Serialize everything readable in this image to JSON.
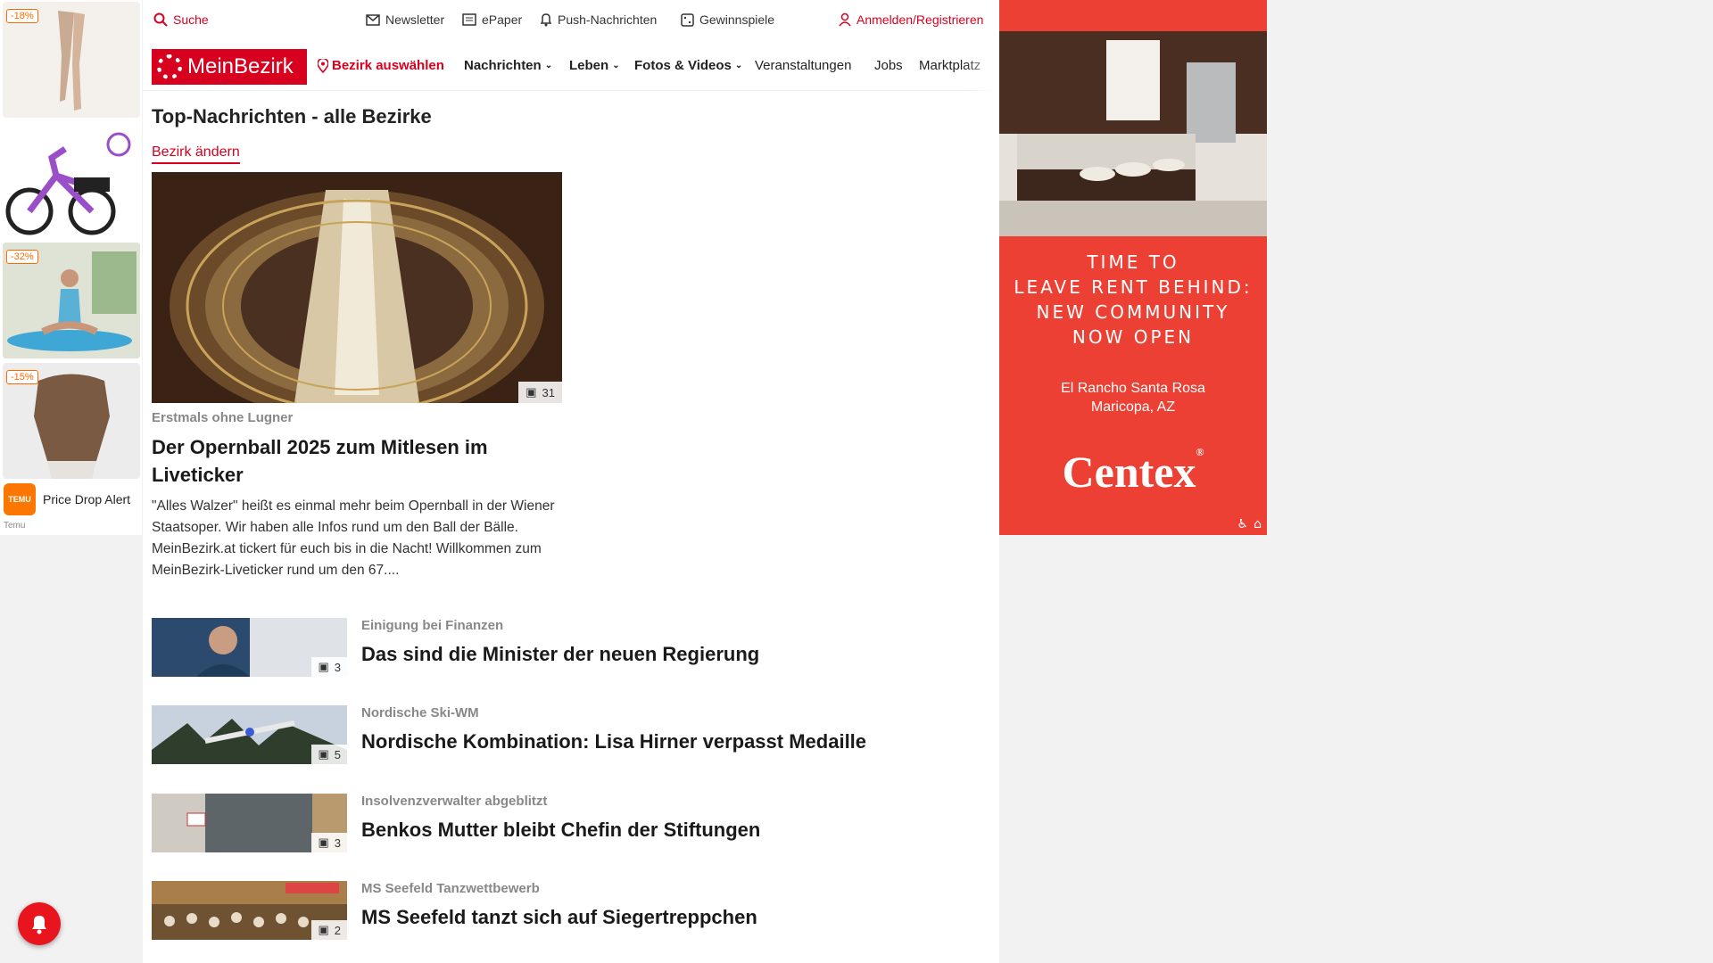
{
  "left_ad": {
    "tiles": [
      {
        "badge": "-18%"
      },
      {
        "badge": ""
      },
      {
        "badge": "-32%"
      },
      {
        "badge": "-15%"
      }
    ],
    "promo_text": "Price Drop Alert",
    "logo_text": "TEMU",
    "brand": "Temu"
  },
  "topbar": {
    "search": "Suche",
    "newsletter": "Newsletter",
    "epaper": "ePaper",
    "push": "Push-Nachrichten",
    "gewinnspiele": "Gewinnspiele",
    "login": "Anmelden/Registrieren"
  },
  "nav": {
    "logo": "MeinBezirk",
    "bezirk": "Bezirk auswählen",
    "items": [
      "Nachrichten",
      "Leben",
      "Fotos & Videos",
      "Veranstaltungen",
      "Jobs",
      "Marktplatz"
    ]
  },
  "section": {
    "title": "Top-Nachrichten - alle Bezirke",
    "change_link": "Bezirk ändern"
  },
  "hero": {
    "photo_count": "31",
    "kicker": "Erstmals ohne Lugner",
    "title": "Der Opernball 2025 zum Mitlesen im Liveticker",
    "teaser": "\"Alles Walzer\" heißt es einmal mehr beim Opernball in der Wiener Staatsoper. Wir haben alle Infos rund um den Ball der Bälle. MeinBezirk.at tickert für euch bis in die Nacht! Willkommen zum MeinBezirk-Liveticker rund um den 67...."
  },
  "articles": [
    {
      "kicker": "Einigung bei Finanzen",
      "title": "Das sind die Minister der neuen Regierung",
      "photo_count": "3"
    },
    {
      "kicker": "Nordische Ski-WM",
      "title": "Nordische Kombination: Lisa Hirner verpasst Medaille",
      "photo_count": "5"
    },
    {
      "kicker": "Insolvenzverwalter abgeblitzt",
      "title": "Benkos Mutter bleibt Chefin der Stiftungen",
      "photo_count": "3"
    },
    {
      "kicker": "MS Seefeld Tanzwettbewerb",
      "title": "MS Seefeld tanzt sich auf Siegertreppchen",
      "photo_count": "2"
    }
  ],
  "right_ad": {
    "headline_lines": [
      "TIME TO",
      "LEAVE RENT BEHIND:",
      "NEW COMMUNITY",
      "NOW OPEN"
    ],
    "location_lines": [
      "El Rancho Santa Rosa",
      "Maricopa, AZ"
    ],
    "brand": "Centex",
    "registered": "®"
  },
  "colors": {
    "brand_red": "#d7001f",
    "ad_red": "#ec4034"
  }
}
